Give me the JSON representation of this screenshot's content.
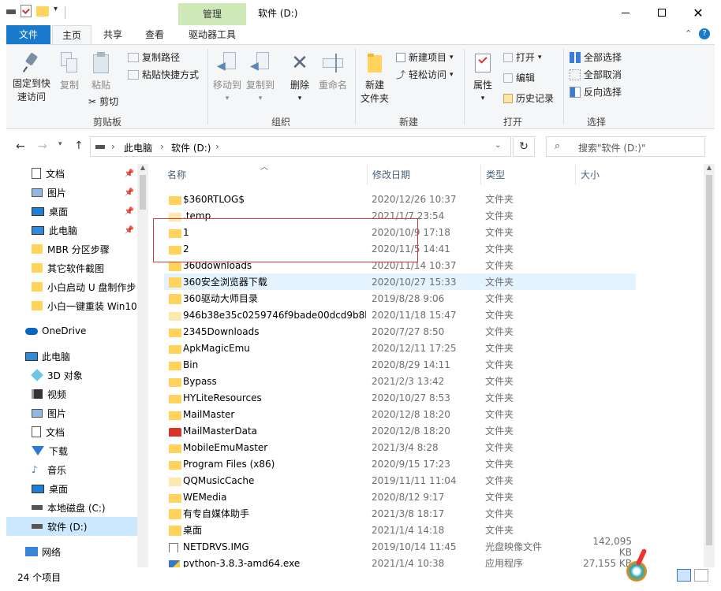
{
  "title": {
    "manage_tab": "管理",
    "window_title": "软件 (D:)"
  },
  "ribbon_tabs": [
    "文件",
    "主页",
    "共享",
    "查看",
    "驱动器工具"
  ],
  "ribbon": {
    "clipboard": {
      "pin": [
        "固定到快",
        "速访问"
      ],
      "copy": "复制",
      "paste": "粘贴",
      "copy_path": "复制路径",
      "paste_shortcut": "粘贴快捷方式",
      "cut": "剪切",
      "label": "剪贴板"
    },
    "organize": {
      "move_to": "移动到",
      "copy_to": "复制到",
      "delete": "删除",
      "rename": "重命名",
      "label": "组织"
    },
    "new": {
      "new_folder": [
        "新建",
        "文件夹"
      ],
      "new_item": "新建项目",
      "easy_access": "轻松访问",
      "label": "新建"
    },
    "open": {
      "properties": "属性",
      "open": "打开",
      "edit": "编辑",
      "history": "历史记录",
      "label": "打开"
    },
    "select": {
      "select_all": "全部选择",
      "select_none": "全部取消",
      "invert": "反向选择",
      "label": "选择"
    }
  },
  "address": {
    "crumbs": [
      "此电脑",
      "软件 (D:)"
    ],
    "search_placeholder": "搜索\"软件 (D:)\""
  },
  "nav": {
    "quick": [
      {
        "label": "文档",
        "icon": "documents-icon",
        "pinned": true
      },
      {
        "label": "图片",
        "icon": "pictures-icon",
        "pinned": true
      },
      {
        "label": "桌面",
        "icon": "desktop-icon",
        "pinned": true
      },
      {
        "label": "此电脑",
        "icon": "pc-icon",
        "pinned": true
      },
      {
        "label": "MBR 分区步骤",
        "icon": "folder-icon",
        "pinned": false
      },
      {
        "label": "其它软件截图",
        "icon": "folder-icon",
        "pinned": false
      },
      {
        "label": "小白启动 U 盘制作步",
        "icon": "folder-icon",
        "pinned": false
      },
      {
        "label": "小白一键重装 Win10",
        "icon": "folder-icon",
        "pinned": false
      }
    ],
    "onedrive": "OneDrive",
    "thispc": "此电脑",
    "pc_items": [
      {
        "label": "3D 对象",
        "icon": "3d-objects-icon"
      },
      {
        "label": "视频",
        "icon": "videos-icon"
      },
      {
        "label": "图片",
        "icon": "pictures-icon"
      },
      {
        "label": "文档",
        "icon": "documents-icon"
      },
      {
        "label": "下载",
        "icon": "downloads-icon"
      },
      {
        "label": "音乐",
        "icon": "music-icon"
      },
      {
        "label": "桌面",
        "icon": "desktop-icon"
      },
      {
        "label": "本地磁盘 (C:)",
        "icon": "drive-icon"
      },
      {
        "label": "软件 (D:)",
        "icon": "drive-icon"
      }
    ],
    "network": "网络"
  },
  "columns": {
    "name": "名称",
    "date": "修改日期",
    "type": "类型",
    "size": "大小"
  },
  "files": [
    {
      "name": "$360RTLOG$",
      "date": "2020/12/26 10:37",
      "type": "文件夹",
      "size": "",
      "icon": "folder-icon"
    },
    {
      "name": ".temp",
      "date": "2021/1/7 23:54",
      "type": "文件夹",
      "size": "",
      "icon": "folder-icon"
    },
    {
      "name": "1",
      "date": "2020/10/9 17:18",
      "type": "文件夹",
      "size": "",
      "icon": "folder-icon"
    },
    {
      "name": "2",
      "date": "2020/11/5 14:41",
      "type": "文件夹",
      "size": "",
      "icon": "folder-icon"
    },
    {
      "name": "360downloads",
      "date": "2020/11/14 10:37",
      "type": "文件夹",
      "size": "",
      "icon": "folder-icon"
    },
    {
      "name": "360安全浏览器下载",
      "date": "2020/10/27 15:33",
      "type": "文件夹",
      "size": "",
      "icon": "folder-icon"
    },
    {
      "name": "360驱动大师目录",
      "date": "2019/8/28 9:06",
      "type": "文件夹",
      "size": "",
      "icon": "folder-icon"
    },
    {
      "name": "946b38e35c0259746f9bade00dcd9b8b",
      "date": "2020/11/18 15:47",
      "type": "文件夹",
      "size": "",
      "icon": "folder-icon"
    },
    {
      "name": "2345Downloads",
      "date": "2020/7/27 8:50",
      "type": "文件夹",
      "size": "",
      "icon": "folder-icon"
    },
    {
      "name": "ApkMagicEmu",
      "date": "2020/12/11 17:25",
      "type": "文件夹",
      "size": "",
      "icon": "folder-icon"
    },
    {
      "name": "Bin",
      "date": "2020/8/29 14:11",
      "type": "文件夹",
      "size": "",
      "icon": "folder-icon"
    },
    {
      "name": "Bypass",
      "date": "2021/2/3 13:42",
      "type": "文件夹",
      "size": "",
      "icon": "folder-icon"
    },
    {
      "name": "HYLiteResources",
      "date": "2020/10/27 8:53",
      "type": "文件夹",
      "size": "",
      "icon": "folder-icon"
    },
    {
      "name": "MailMaster",
      "date": "2020/12/8 18:20",
      "type": "文件夹",
      "size": "",
      "icon": "folder-icon"
    },
    {
      "name": "MailMasterData",
      "date": "2020/12/8 18:20",
      "type": "文件夹",
      "size": "",
      "icon": "mail-icon"
    },
    {
      "name": "MobileEmuMaster",
      "date": "2021/3/4 8:28",
      "type": "文件夹",
      "size": "",
      "icon": "folder-icon"
    },
    {
      "name": "Program Files (x86)",
      "date": "2020/9/15 17:23",
      "type": "文件夹",
      "size": "",
      "icon": "folder-icon"
    },
    {
      "name": "QQMusicCache",
      "date": "2019/11/11 11:04",
      "type": "文件夹",
      "size": "",
      "icon": "folder-icon"
    },
    {
      "name": "WEMedia",
      "date": "2020/8/12 9:17",
      "type": "文件夹",
      "size": "",
      "icon": "folder-icon"
    },
    {
      "name": "有专自媒体助手",
      "date": "2021/3/8 18:17",
      "type": "文件夹",
      "size": "",
      "icon": "folder-icon"
    },
    {
      "name": "桌面",
      "date": "2021/1/4 14:18",
      "type": "文件夹",
      "size": "",
      "icon": "folder-icon"
    },
    {
      "name": "NETDRVS.IMG",
      "date": "2019/10/14 11:45",
      "type": "光盘映像文件",
      "size": "142,095 KB",
      "icon": "disc-image-icon"
    },
    {
      "name": "python-3.8.3-amd64.exe",
      "date": "2021/1/4 10:38",
      "type": "应用程序",
      "size": "27,155 KB",
      "icon": "installer-icon"
    }
  ],
  "status": {
    "count": "24 个项目"
  },
  "colors": {
    "accent": "#1979ca",
    "highlight_box": "#d9383a",
    "hover_row": "#e5f3ff",
    "folder": "#ffd35c"
  }
}
